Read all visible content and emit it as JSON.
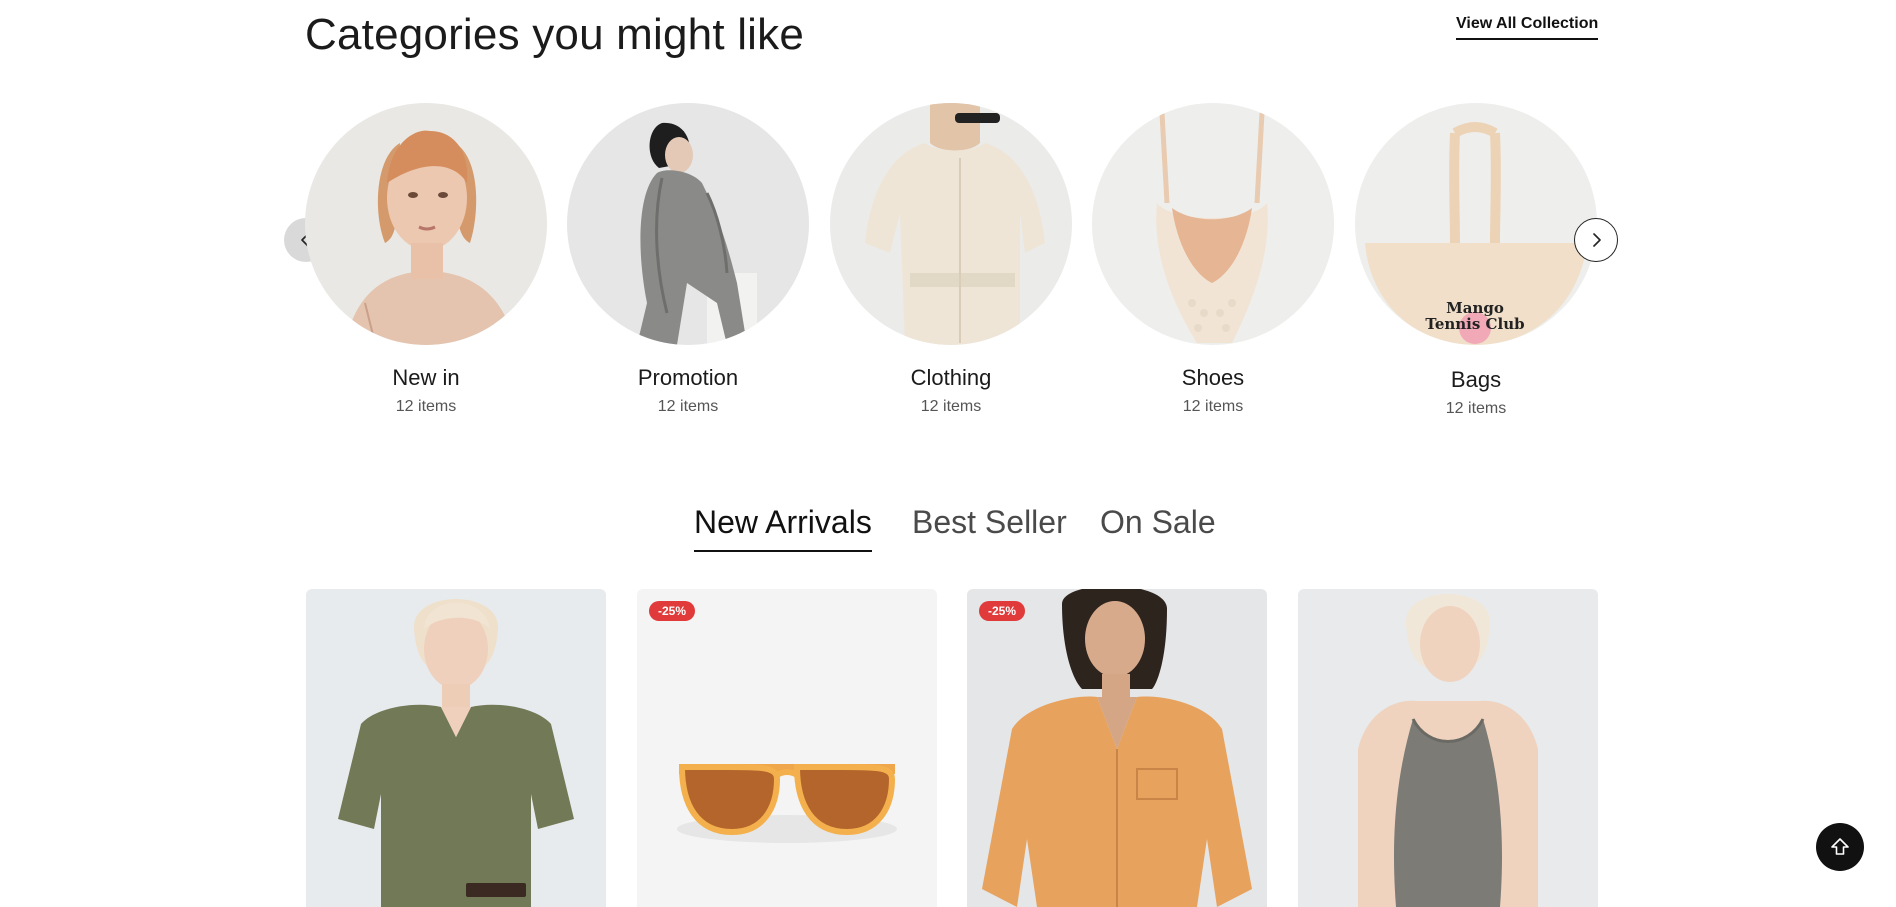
{
  "section": {
    "title": "Categories you might like",
    "view_all": "View All Collection"
  },
  "categories": [
    {
      "name": "New in",
      "count": "12 items"
    },
    {
      "name": "Promotion",
      "count": "12 items"
    },
    {
      "name": "Clothing",
      "count": "12 items"
    },
    {
      "name": "Shoes",
      "count": "12 items"
    },
    {
      "name": "Bags",
      "count": "12 items"
    }
  ],
  "bag_print": {
    "line1": "Mango",
    "line2": "Tennis Club"
  },
  "carousel": {
    "prev_icon": "chevron-left-icon",
    "next_icon": "chevron-right-icon"
  },
  "tabs": [
    {
      "label": "New Arrivals",
      "active": true
    },
    {
      "label": "Best Seller",
      "active": false
    },
    {
      "label": "On Sale",
      "active": false
    }
  ],
  "products": [
    {
      "badge": ""
    },
    {
      "badge": "-25%"
    },
    {
      "badge": "-25%"
    },
    {
      "badge": ""
    }
  ],
  "scroll_top": {
    "icon": "arrow-up-icon"
  },
  "colors": {
    "badge": "#e03a3a",
    "accent": "#111111",
    "background": "#ffffff"
  }
}
